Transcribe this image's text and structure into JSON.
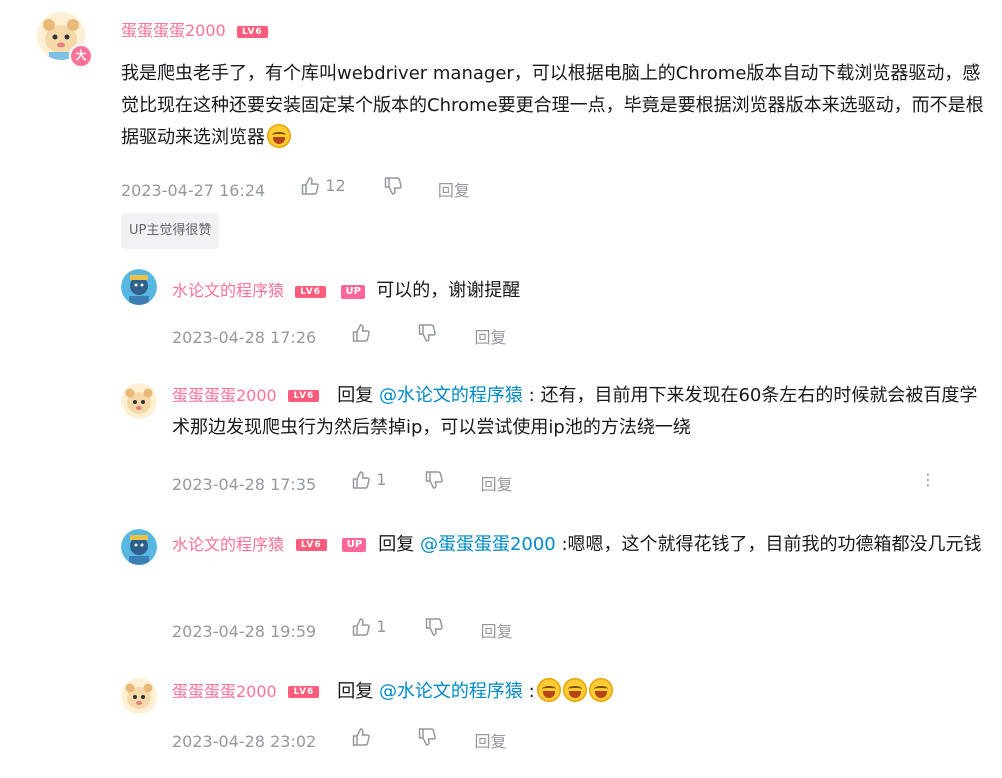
{
  "main_comment": {
    "user": "蛋蛋蛋蛋2000",
    "level": "LV6",
    "text": "我是爬虫老手了，有个库叫webdriver manager，可以根据电脑上的Chrome版本自动下载浏览器驱动，感觉比现在这种还要安装固定某个版本的Chrome要更合理一点，毕竟是要根据浏览器版本来选驱动，而不是根据驱动来选浏览器",
    "time": "2023-04-27 16:24",
    "likes": "12",
    "reply_label": "回复",
    "up_tag": "UP主觉得很赞",
    "avatar_badge": "大"
  },
  "replies": [
    {
      "user": "水论文的程序猿",
      "level": "LV6",
      "up_badge": "UP",
      "prefix": "",
      "mention": "",
      "text": "可以的，谢谢提醒",
      "time": "2023-04-28 17:26",
      "likes": "",
      "reply_label": "回复"
    },
    {
      "user": "蛋蛋蛋蛋2000",
      "level": "LV6",
      "prefix": "回复 ",
      "mention": "@水论文的程序猿",
      "text": " : 还有，目前用下来发现在60条左右的时候就会被百度学术那边发现爬虫行为然后禁掉ip，可以尝试使用ip池的方法绕一绕",
      "time": "2023-04-28 17:35",
      "likes": "1",
      "reply_label": "回复",
      "more_icon": "⋮"
    },
    {
      "user": "水论文的程序猿",
      "level": "LV6",
      "up_badge": "UP",
      "prefix": "回复 ",
      "mention": "@蛋蛋蛋蛋2000",
      "text": " :嗯嗯，这个就得花钱了，目前我的功德箱都没几元钱",
      "time": "2023-04-28 19:59",
      "likes": "1",
      "reply_label": "回复"
    },
    {
      "user": "蛋蛋蛋蛋2000",
      "level": "LV6",
      "prefix": "回复 ",
      "mention": "@水论文的程序猿",
      "text": " :",
      "time": "2023-04-28 23:02",
      "likes": "",
      "reply_label": "回复"
    }
  ],
  "icons": {
    "like": "thumbs-up-icon",
    "dislike": "thumbs-down-icon",
    "emoji": "laughing-cry-emoji"
  },
  "colors": {
    "username": "#fb7299",
    "mention": "#008ac5",
    "meta": "#9499a0",
    "level_badge": "#ff5c7c"
  }
}
